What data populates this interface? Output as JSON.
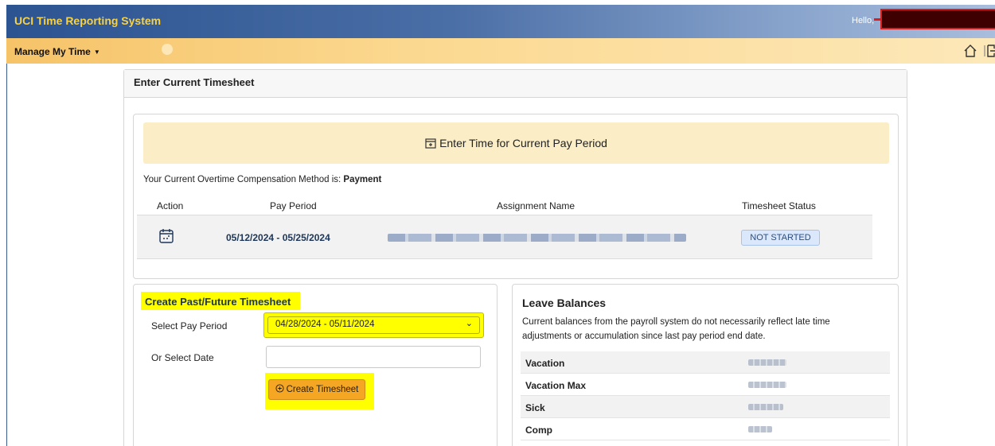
{
  "header": {
    "title": "UCI Time Reporting System",
    "greeting": "Hello,"
  },
  "nav": {
    "menu_label": "Manage My Time"
  },
  "main": {
    "card_title": "Enter Current Timesheet",
    "enter_time_label": "Enter Time for Current Pay Period",
    "ot_text": "Your Current Overtime Compensation Method is: ",
    "ot_value": "Payment",
    "table": {
      "headers": [
        "Action",
        "Pay Period",
        "Assignment Name",
        "Timesheet Status"
      ],
      "rows": [
        {
          "pay_period": "05/12/2024 - 05/25/2024",
          "status": "NOT STARTED"
        }
      ]
    }
  },
  "create": {
    "title": "Create Past/Future Timesheet",
    "select_label": "Select Pay Period",
    "selected_period": "04/28/2024 - 05/11/2024",
    "date_label": "Or Select Date",
    "date_value": "",
    "button_label": "Create Timesheet"
  },
  "leave": {
    "title": "Leave Balances",
    "description": "Current balances from the payroll system do not necessarily reflect late time adjustments or accumulation since last pay period end date.",
    "rows": [
      {
        "name": "Vacation"
      },
      {
        "name": "Vacation Max"
      },
      {
        "name": "Sick"
      },
      {
        "name": "Comp"
      }
    ]
  },
  "colors": {
    "header_blue": "#2c5491",
    "title_gold": "#f5d24a",
    "nav_orange": "#f6c368",
    "highlight_yellow": "#ffff00",
    "button_orange": "#f5a623",
    "banner_cream": "#fbedc5"
  },
  "icons": [
    "chevron-down-icon",
    "home-icon",
    "logout-icon",
    "calendar-plus-icon",
    "calendar-edit-icon",
    "plus-circle-icon"
  ]
}
